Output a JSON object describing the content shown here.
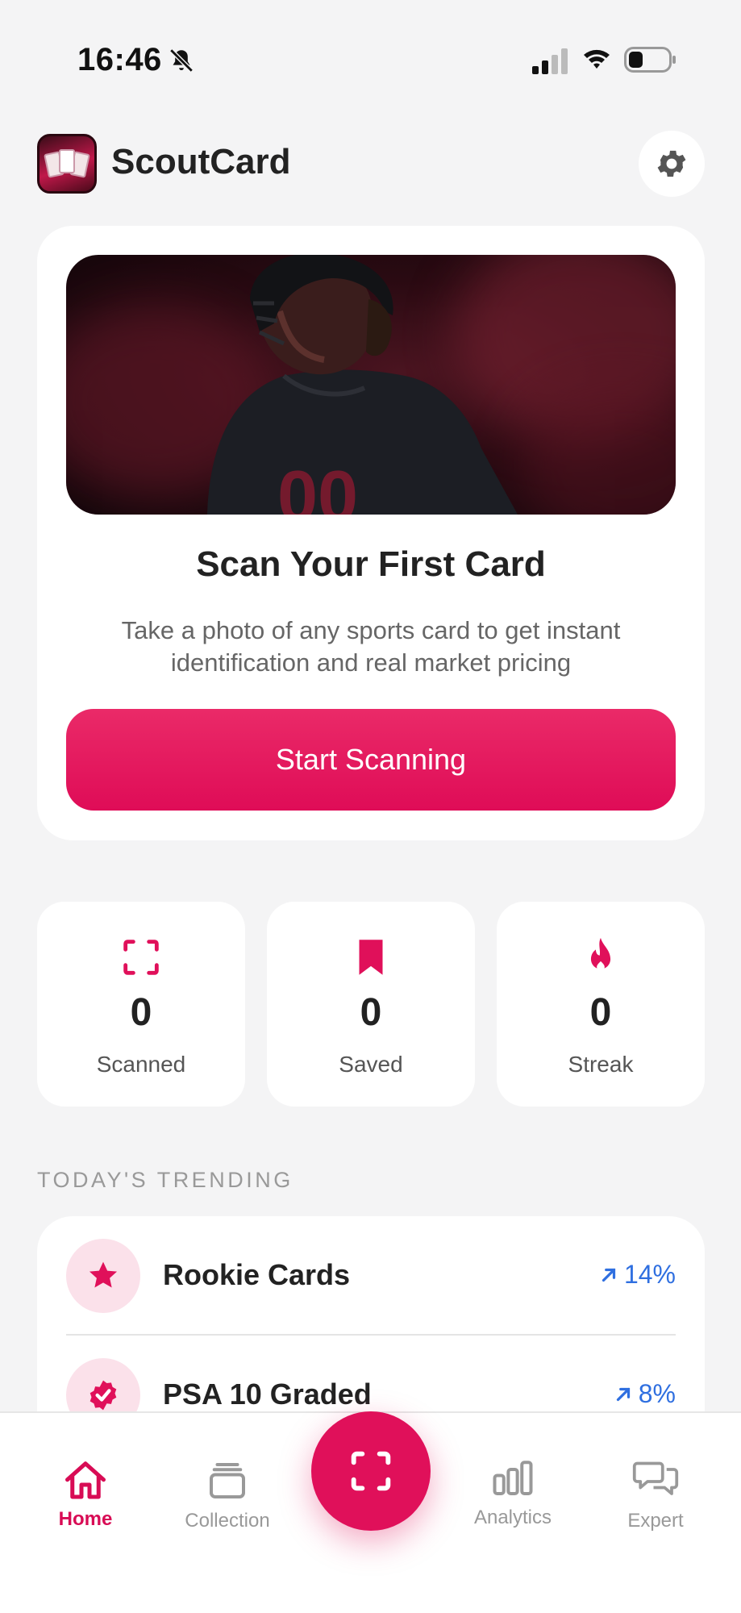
{
  "status_bar": {
    "time": "16:46"
  },
  "header": {
    "app_name": "ScoutCard"
  },
  "hero": {
    "title": "Scan Your First Card",
    "subtitle": "Take a photo of any sports card to get instant identification and real market pricing",
    "button_label": "Start Scanning"
  },
  "stats": [
    {
      "icon": "scan-frame-icon",
      "value": "0",
      "label": "Scanned"
    },
    {
      "icon": "bookmark-icon",
      "value": "0",
      "label": "Saved"
    },
    {
      "icon": "flame-icon",
      "value": "0",
      "label": "Streak"
    }
  ],
  "trending": {
    "section_label": "TODAY'S TRENDING",
    "items": [
      {
        "icon": "star-icon",
        "name": "Rookie Cards",
        "change": "14%"
      },
      {
        "icon": "verified-badge-icon",
        "name": "PSA 10 Graded",
        "change": "8%"
      }
    ]
  },
  "tab_bar": {
    "tabs": [
      {
        "icon": "home-icon",
        "label": "Home",
        "active": true
      },
      {
        "icon": "collection-icon",
        "label": "Collection",
        "active": false
      },
      {
        "icon": "analytics-icon",
        "label": "Analytics",
        "active": false
      },
      {
        "icon": "chat-bubbles-icon",
        "label": "Expert",
        "active": false
      }
    ],
    "center_action_icon": "scan-frame-icon"
  },
  "colors": {
    "accent": "#E0105A",
    "trend_up": "#2F6FE0",
    "background": "#F4F4F5",
    "card": "#FFFFFF"
  }
}
